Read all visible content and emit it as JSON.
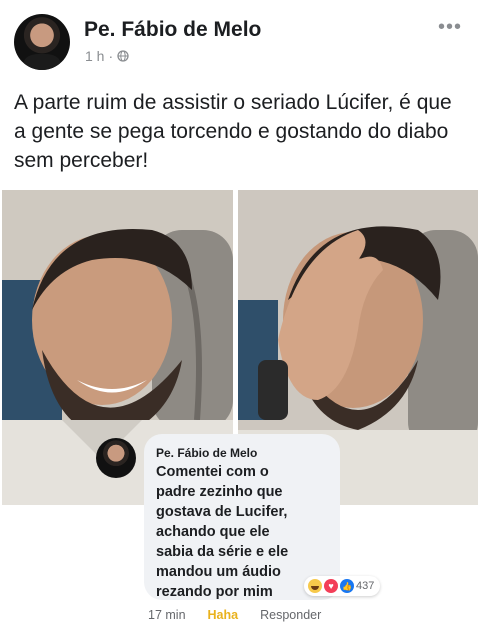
{
  "post": {
    "author": "Pe. Fábio de Melo",
    "time": "1 h",
    "separator": "·",
    "text": "A parte ruim de assistir o seriado Lúcifer, é que a gente se pega torcendo e gostando do diabo sem perceber!",
    "more_icon": "more-dots-icon"
  },
  "comment": {
    "author": "Pe. Fábio de Melo",
    "text": "Comentei com o\npadre zezinho que\ngostava de Lucifer,\nachando que ele\nsabia da série e ele\nmandou um áudio\nrezando por mim",
    "reaction_count": "437",
    "time": "17 min",
    "reaction_label": "Haha",
    "reply_label": "Responder"
  },
  "colors": {
    "haha": "#e9b21d",
    "love": "#f33e58",
    "like": "#1877f2",
    "meta_gray": "#8a8d91"
  }
}
